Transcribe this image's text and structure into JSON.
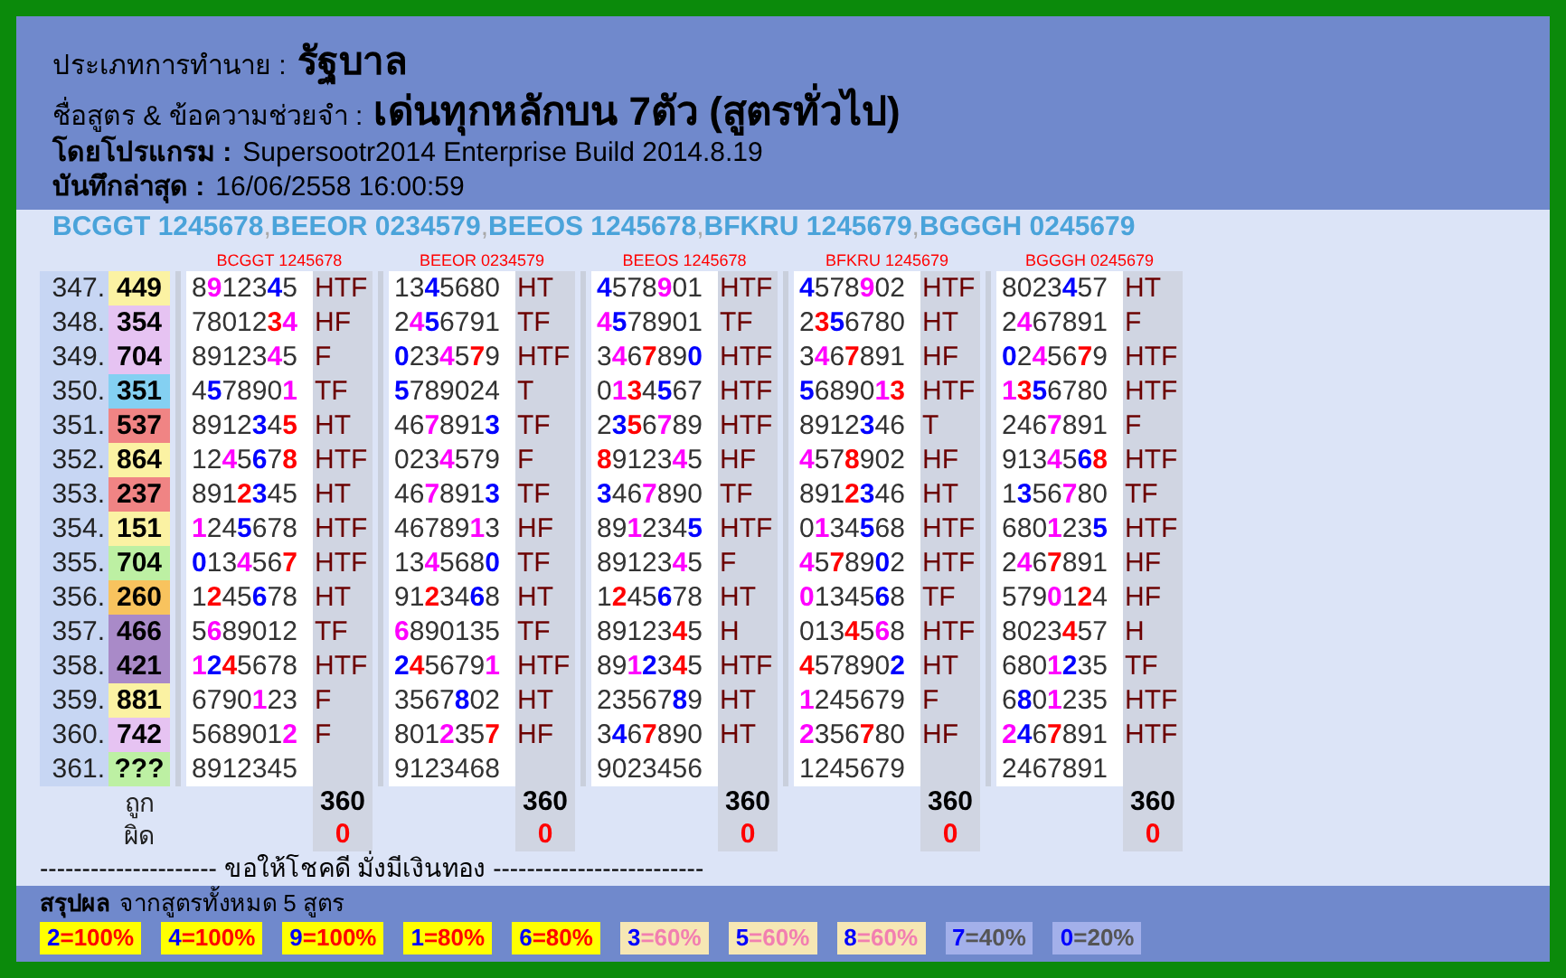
{
  "header": {
    "type_label": "ประเภทการทำนาย :",
    "type_value": "รัฐบาล",
    "formula_label": "ชื่อสูตร & ข้อความช่วยจำ :",
    "formula_value": "เด่นทุกหลักบน 7ตัว (สูตรทั่วไป)",
    "program_label": "โดยโปรแกรม :",
    "program_value": "Supersootr2014 Enterprise Build 2014.8.19",
    "saved_label": "บันทึกล่าสุด :",
    "saved_value": "16/06/2558 16:00:59"
  },
  "formulas": [
    "BCGGT 1245678",
    "BEEOR 0234579",
    "BEEOS 1245678",
    "BFKRU 1245679",
    "BGGGH 0245679"
  ],
  "separator": ",",
  "columns": [
    "BCGGT 1245678",
    "BEEOR 0234579",
    "BEEOS 1245678",
    "BFKRU 1245679",
    "BGGGH 0245679"
  ],
  "rows": [
    {
      "number": "347.",
      "result": "449",
      "color": "#fbf2a3",
      "sets": [
        {
          "digits": "8912345",
          "hit": "HTF"
        },
        {
          "digits": "1345680",
          "hit": "HT"
        },
        {
          "digits": "4578901",
          "hit": "HTF"
        },
        {
          "digits": "4578902",
          "hit": "HTF"
        },
        {
          "digits": "8023457",
          "hit": "HT"
        }
      ]
    },
    {
      "number": "348.",
      "result": "354",
      "color": "#e6c3f2",
      "sets": [
        {
          "digits": "7801234",
          "hit": "HF"
        },
        {
          "digits": "2456791",
          "hit": "TF"
        },
        {
          "digits": "4578901",
          "hit": "TF"
        },
        {
          "digits": "2356780",
          "hit": "HT"
        },
        {
          "digits": "2467891",
          "hit": "F"
        }
      ]
    },
    {
      "number": "349.",
      "result": "704",
      "color": "#e6c3f2",
      "sets": [
        {
          "digits": "8912345",
          "hit": "F"
        },
        {
          "digits": "0234579",
          "hit": "HTF"
        },
        {
          "digits": "3467890",
          "hit": "HTF"
        },
        {
          "digits": "3467891",
          "hit": "HF"
        },
        {
          "digits": "0245679",
          "hit": "HTF"
        }
      ]
    },
    {
      "number": "350.",
      "result": "351",
      "color": "#84d0f2",
      "sets": [
        {
          "digits": "4578901",
          "hit": "TF"
        },
        {
          "digits": "5789024",
          "hit": "T"
        },
        {
          "digits": "0134567",
          "hit": "HTF"
        },
        {
          "digits": "5689013",
          "hit": "HTF"
        },
        {
          "digits": "1356780",
          "hit": "HTF"
        }
      ]
    },
    {
      "number": "351.",
      "result": "537",
      "color": "#f08484",
      "sets": [
        {
          "digits": "8912345",
          "hit": "HT"
        },
        {
          "digits": "4678913",
          "hit": "TF"
        },
        {
          "digits": "2356789",
          "hit": "HTF"
        },
        {
          "digits": "8912346",
          "hit": "T"
        },
        {
          "digits": "2467891",
          "hit": "F"
        }
      ]
    },
    {
      "number": "352.",
      "result": "864",
      "color": "#fbf2a3",
      "sets": [
        {
          "digits": "1245678",
          "hit": "HTF"
        },
        {
          "digits": "0234579",
          "hit": "F"
        },
        {
          "digits": "8912345",
          "hit": "HF"
        },
        {
          "digits": "4578902",
          "hit": "HF"
        },
        {
          "digits": "9134568",
          "hit": "HTF"
        }
      ]
    },
    {
      "number": "353.",
      "result": "237",
      "color": "#f08484",
      "sets": [
        {
          "digits": "8912345",
          "hit": "HT"
        },
        {
          "digits": "4678913",
          "hit": "TF"
        },
        {
          "digits": "3467890",
          "hit": "TF"
        },
        {
          "digits": "8912346",
          "hit": "HT"
        },
        {
          "digits": "1356780",
          "hit": "TF"
        }
      ]
    },
    {
      "number": "354.",
      "result": "151",
      "color": "#fbf2a3",
      "sets": [
        {
          "digits": "1245678",
          "hit": "HTF"
        },
        {
          "digits": "4678913",
          "hit": "HF"
        },
        {
          "digits": "8912345",
          "hit": "HTF"
        },
        {
          "digits": "0134568",
          "hit": "HTF"
        },
        {
          "digits": "6801235",
          "hit": "HTF"
        }
      ]
    },
    {
      "number": "355.",
      "result": "704",
      "color": "#bdf0a3",
      "sets": [
        {
          "digits": "0134567",
          "hit": "HTF"
        },
        {
          "digits": "1345680",
          "hit": "TF"
        },
        {
          "digits": "8912345",
          "hit": "F"
        },
        {
          "digits": "4578902",
          "hit": "HTF"
        },
        {
          "digits": "2467891",
          "hit": "HF"
        }
      ]
    },
    {
      "number": "356.",
      "result": "260",
      "color": "#f8c35e",
      "sets": [
        {
          "digits": "1245678",
          "hit": "HT"
        },
        {
          "digits": "9123468",
          "hit": "HT"
        },
        {
          "digits": "1245678",
          "hit": "HT"
        },
        {
          "digits": "0134568",
          "hit": "TF"
        },
        {
          "digits": "5790124",
          "hit": "HF"
        }
      ]
    },
    {
      "number": "357.",
      "result": "466",
      "color": "#a98ac8",
      "sets": [
        {
          "digits": "5689012",
          "hit": "TF"
        },
        {
          "digits": "6890135",
          "hit": "TF"
        },
        {
          "digits": "8912345",
          "hit": "H"
        },
        {
          "digits": "0134568",
          "hit": "HTF"
        },
        {
          "digits": "8023457",
          "hit": "H"
        }
      ]
    },
    {
      "number": "358.",
      "result": "421",
      "color": "#a98ac8",
      "sets": [
        {
          "digits": "1245678",
          "hit": "HTF"
        },
        {
          "digits": "2456791",
          "hit": "HTF"
        },
        {
          "digits": "8912345",
          "hit": "HTF"
        },
        {
          "digits": "4578902",
          "hit": "HT"
        },
        {
          "digits": "6801235",
          "hit": "TF"
        }
      ]
    },
    {
      "number": "359.",
      "result": "881",
      "color": "#fbf2a3",
      "sets": [
        {
          "digits": "6790123",
          "hit": "F"
        },
        {
          "digits": "3567802",
          "hit": "HT"
        },
        {
          "digits": "2356789",
          "hit": "HT"
        },
        {
          "digits": "1245679",
          "hit": "F"
        },
        {
          "digits": "6801235",
          "hit": "HTF"
        }
      ]
    },
    {
      "number": "360.",
      "result": "742",
      "color": "#e6c3f2",
      "sets": [
        {
          "digits": "5689012",
          "hit": "F"
        },
        {
          "digits": "8012357",
          "hit": "HF"
        },
        {
          "digits": "3467890",
          "hit": "HT"
        },
        {
          "digits": "2356780",
          "hit": "HF"
        },
        {
          "digits": "2467891",
          "hit": "HTF"
        }
      ]
    },
    {
      "number": "361.",
      "result": "???",
      "color": "#bdf0a3",
      "sets": [
        {
          "digits": "8912345"
        },
        {
          "digits": "9123468"
        },
        {
          "digits": "9023456"
        },
        {
          "digits": "1245679"
        },
        {
          "digits": "2467891"
        }
      ]
    }
  ],
  "totals": {
    "correct_label": "ถูก",
    "wrong_label": "ผิด",
    "columns": [
      {
        "correct": "360",
        "wrong": "0"
      },
      {
        "correct": "360",
        "wrong": "0"
      },
      {
        "correct": "360",
        "wrong": "0"
      },
      {
        "correct": "360",
        "wrong": "0"
      },
      {
        "correct": "360",
        "wrong": "0"
      }
    ]
  },
  "blessing": "--------------------- ขอให้โชคดี มั่งมีเงินทอง -------------------------",
  "summary": {
    "title": "สรุปผล",
    "subtitle": "จากสูตรทั้งหมด 5 สูตร",
    "chips": [
      {
        "digit": "2",
        "value": "=100%",
        "kind": "high"
      },
      {
        "digit": "4",
        "value": "=100%",
        "kind": "high"
      },
      {
        "digit": "9",
        "value": "=100%",
        "kind": "high"
      },
      {
        "digit": "1",
        "value": "=80%",
        "kind": "high"
      },
      {
        "digit": "6",
        "value": "=80%",
        "kind": "high"
      },
      {
        "digit": "3",
        "value": "=60%",
        "kind": "mid"
      },
      {
        "digit": "5",
        "value": "=60%",
        "kind": "mid"
      },
      {
        "digit": "8",
        "value": "=60%",
        "kind": "mid"
      },
      {
        "digit": "7",
        "value": "=40%",
        "kind": "low"
      },
      {
        "digit": "0",
        "value": "=20%",
        "kind": "low"
      }
    ]
  }
}
